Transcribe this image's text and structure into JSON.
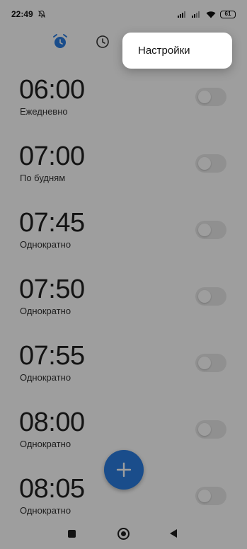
{
  "status_bar": {
    "time": "22:49",
    "battery": "61",
    "icons": [
      "bell-off-icon",
      "signal-icon",
      "signal-icon",
      "wifi-icon",
      "battery-icon"
    ]
  },
  "tabs": [
    {
      "icon": "alarm-clock-icon",
      "selected": true
    },
    {
      "icon": "clock-icon",
      "selected": false
    }
  ],
  "colors": {
    "accent": "#2a7de1",
    "scrim": "rgba(0,0,0,0.38)",
    "toggle_off": "#e8e8e8"
  },
  "alarms": [
    {
      "time": "06:00",
      "repeat": "Ежедневно",
      "enabled": false
    },
    {
      "time": "07:00",
      "repeat": "По будням",
      "enabled": false
    },
    {
      "time": "07:45",
      "repeat": "Однократно",
      "enabled": false
    },
    {
      "time": "07:50",
      "repeat": "Однократно",
      "enabled": false
    },
    {
      "time": "07:55",
      "repeat": "Однократно",
      "enabled": false
    },
    {
      "time": "08:00",
      "repeat": "Однократно",
      "enabled": false
    },
    {
      "time": "08:05",
      "repeat": "Однократно",
      "enabled": false
    }
  ],
  "fab": {
    "icon": "plus-icon"
  },
  "popup_menu": {
    "items": [
      {
        "label": "Настройки"
      }
    ]
  },
  "nav_bar": {
    "icons": [
      "recents-icon",
      "home-icon",
      "back-icon"
    ]
  }
}
